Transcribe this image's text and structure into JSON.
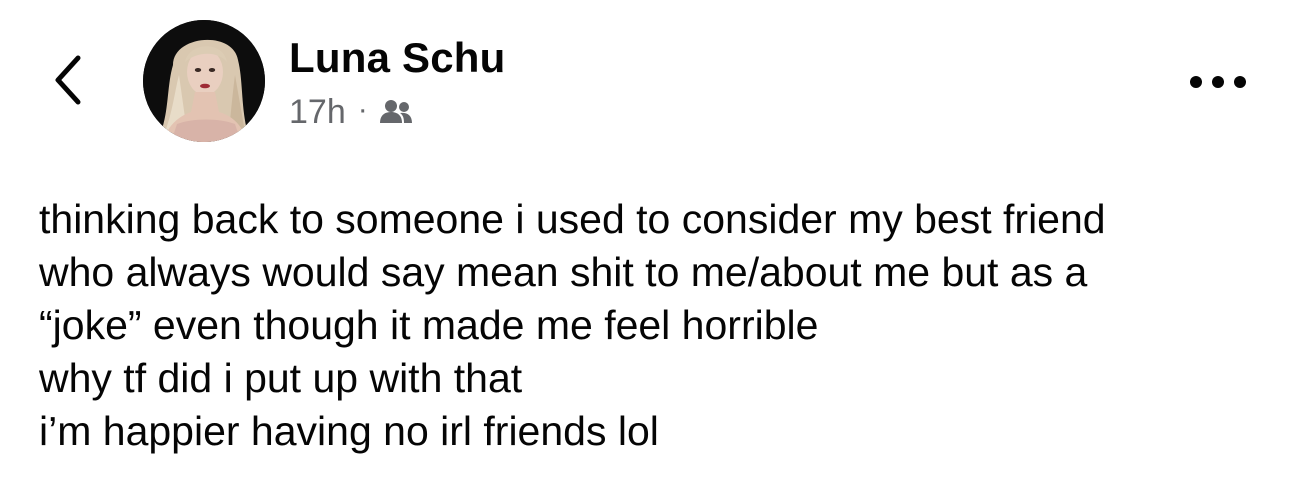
{
  "post": {
    "author": "Luna Schu",
    "time": "17h",
    "separator": "·",
    "audience_icon": "friends-icon",
    "lines": [
      "thinking back to someone i used to consider my best friend",
      "who always would say mean shit to me/about me but as a",
      "“joke” even though it made me feel horrible",
      "why tf did i put up with that",
      "i’m happier having no irl friends lol"
    ]
  },
  "icons": {
    "back": "chevron-left-icon",
    "more": "more-horizontal-icon"
  },
  "colors": {
    "text": "#050505",
    "secondary_text": "#65676b",
    "background": "#ffffff"
  }
}
